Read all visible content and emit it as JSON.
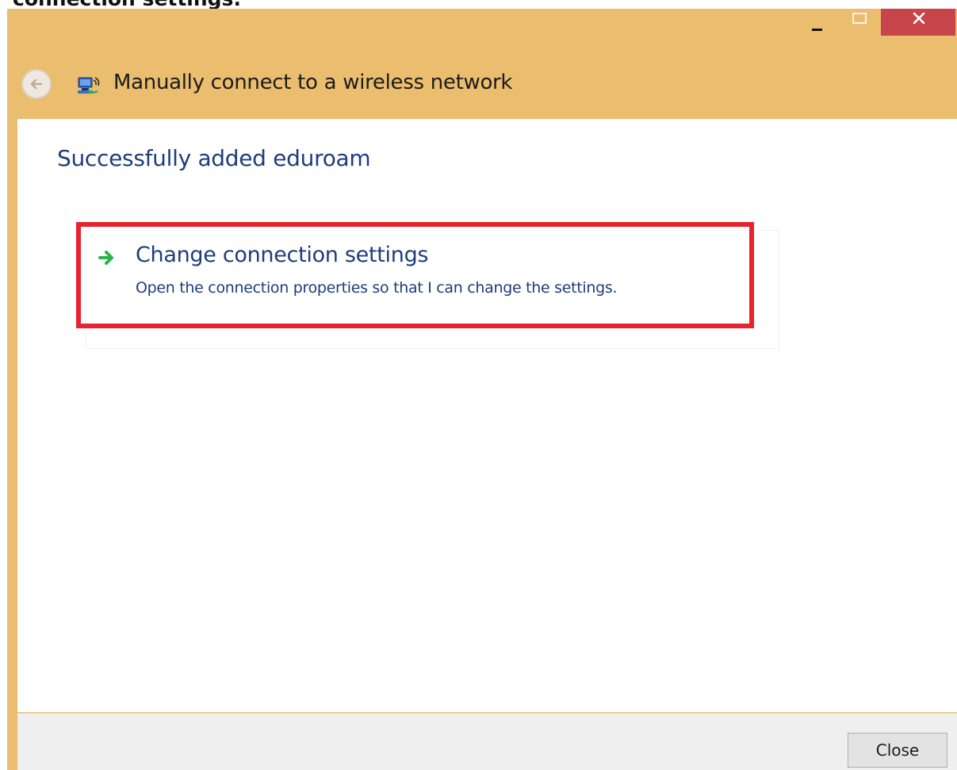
{
  "caption": {
    "text": "connection settings."
  },
  "window": {
    "title": "Manually connect to a wireless network",
    "controls": {
      "minimize": "minimize",
      "maximize": "maximize",
      "close": "close"
    },
    "icons": {
      "back": "back-arrow-icon",
      "network": "wireless-network-icon"
    },
    "colors": {
      "chrome": "#ebbd6f",
      "close_button": "#c7444a",
      "accent_text": "#1e3d7b",
      "highlight_border": "#e8232f",
      "arrow": "#2bb34a"
    }
  },
  "main": {
    "heading": "Successfully added eduroam",
    "command_link": {
      "title": "Change connection settings",
      "description": "Open the connection properties so that I can change the settings.",
      "icon": "green-arrow-icon"
    }
  },
  "footer": {
    "close_label": "Close"
  }
}
